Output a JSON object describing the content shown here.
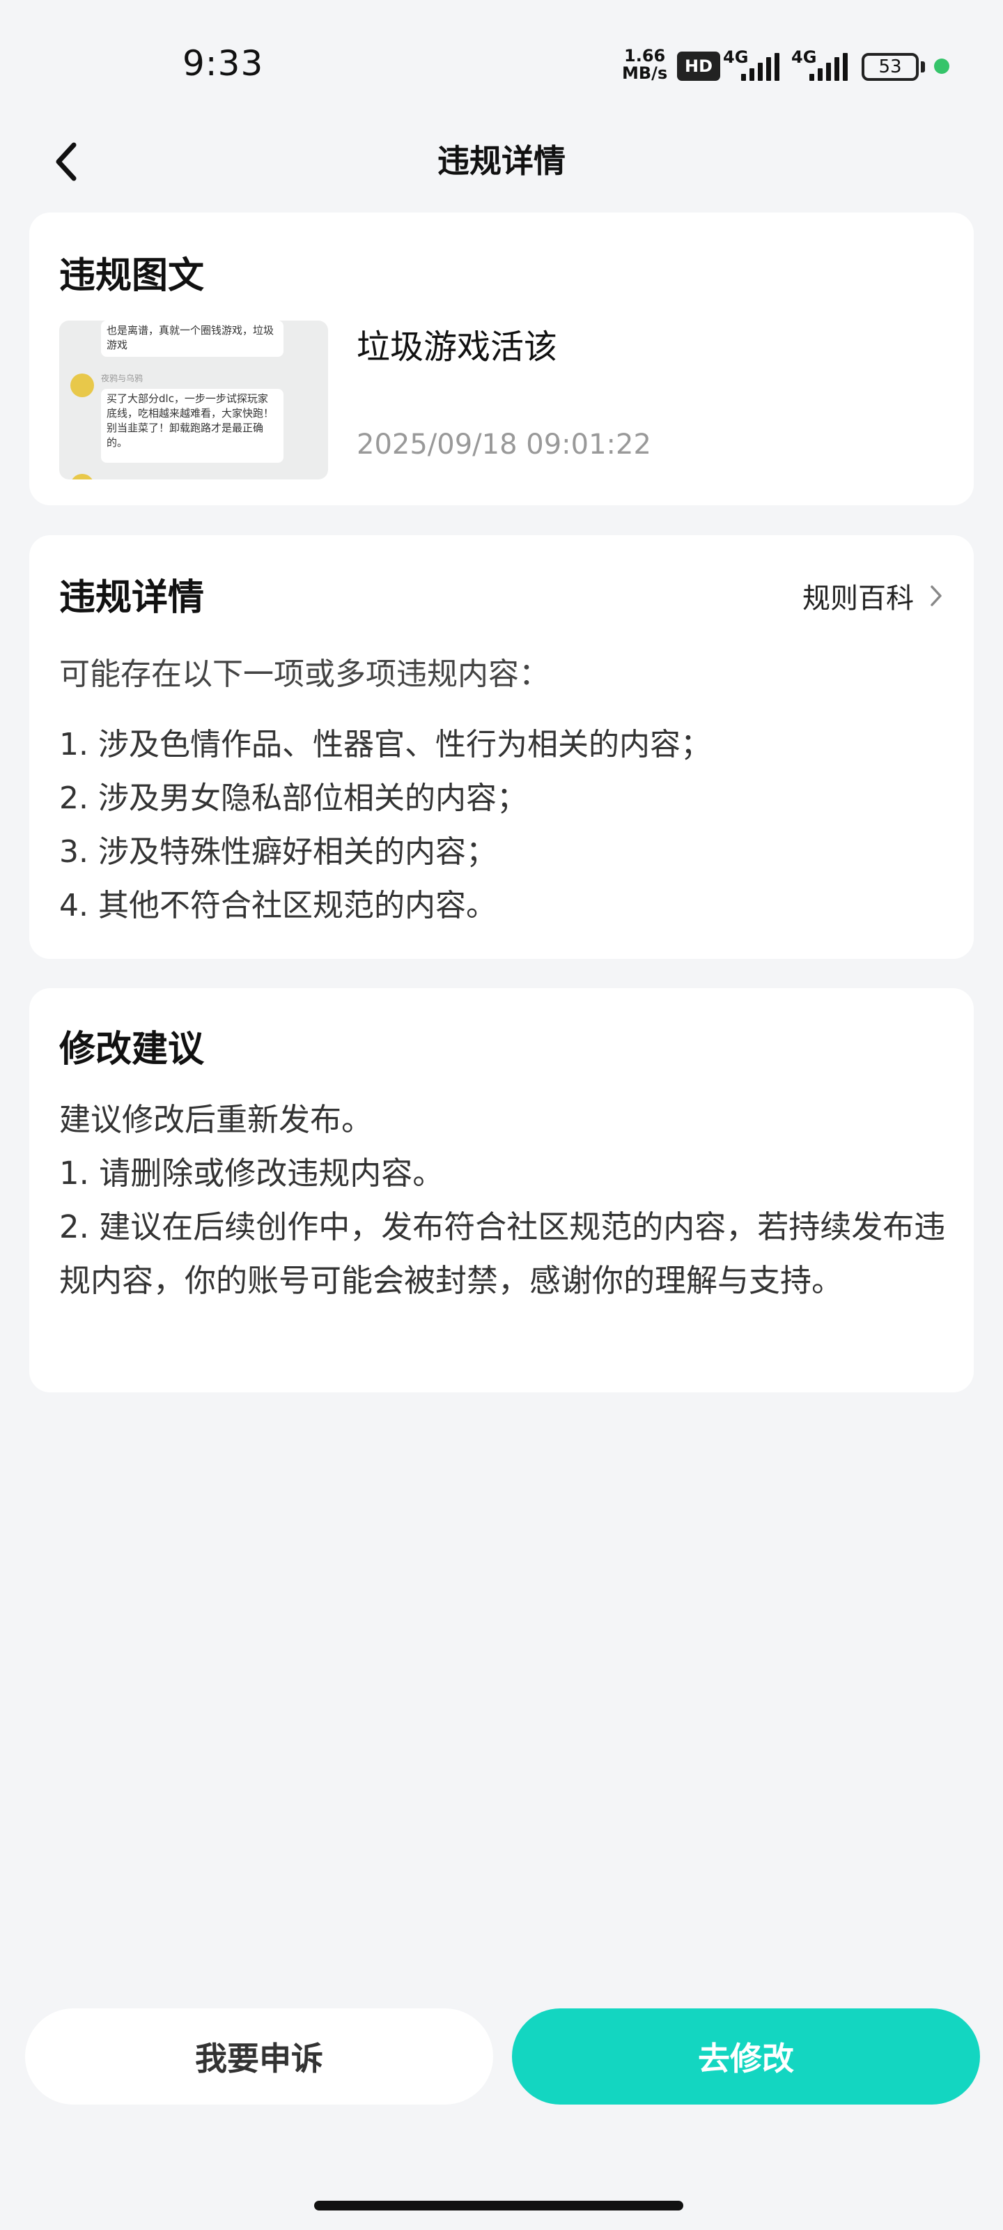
{
  "status_bar": {
    "time": "9:33",
    "net_speed_value": "1.66",
    "net_speed_unit": "MB/s",
    "hd_badge": "HD",
    "signal1_label": "4G",
    "signal2_label": "4G",
    "battery": "53",
    "indicator_color": "#35c46a"
  },
  "header": {
    "title": "违规详情",
    "back_icon": "chevron-left-icon"
  },
  "violation_content": {
    "title": "违规图文",
    "thumbnail": {
      "bubble1": "也是离谱，真就一个圈钱游戏，垃圾游戏",
      "name": "夜鸦与乌鸦",
      "bubble2": "买了大部分dlc，一步一步试探玩家底线，吃相越来越难看，大家快跑！别当韭菜了！卸载跑路才是最正确的。"
    },
    "post_title": "垃圾游戏活该",
    "post_time": "2025/09/18 09:01:22"
  },
  "violation_details": {
    "title": "违规详情",
    "rule_link": "规则百科",
    "intro": "可能存在以下一项或多项违规内容：",
    "items": [
      "1. 涉及色情作品、性器官、性行为相关的内容；",
      "2. 涉及男女隐私部位相关的内容；",
      "3. 涉及特殊性癖好相关的内容；",
      "4. 其他不符合社区规范的内容。"
    ]
  },
  "suggestions": {
    "title": "修改建议",
    "lines": [
      "建议修改后重新发布。",
      "1. 请删除或修改违规内容。",
      "2. 建议在后续创作中，发布符合社区规范的内容，若持续发布违规内容，你的账号可能会被封禁，感谢你的理解与支持。"
    ]
  },
  "actions": {
    "appeal": "我要申诉",
    "modify": "去修改",
    "modify_color": "#13d6c1"
  }
}
